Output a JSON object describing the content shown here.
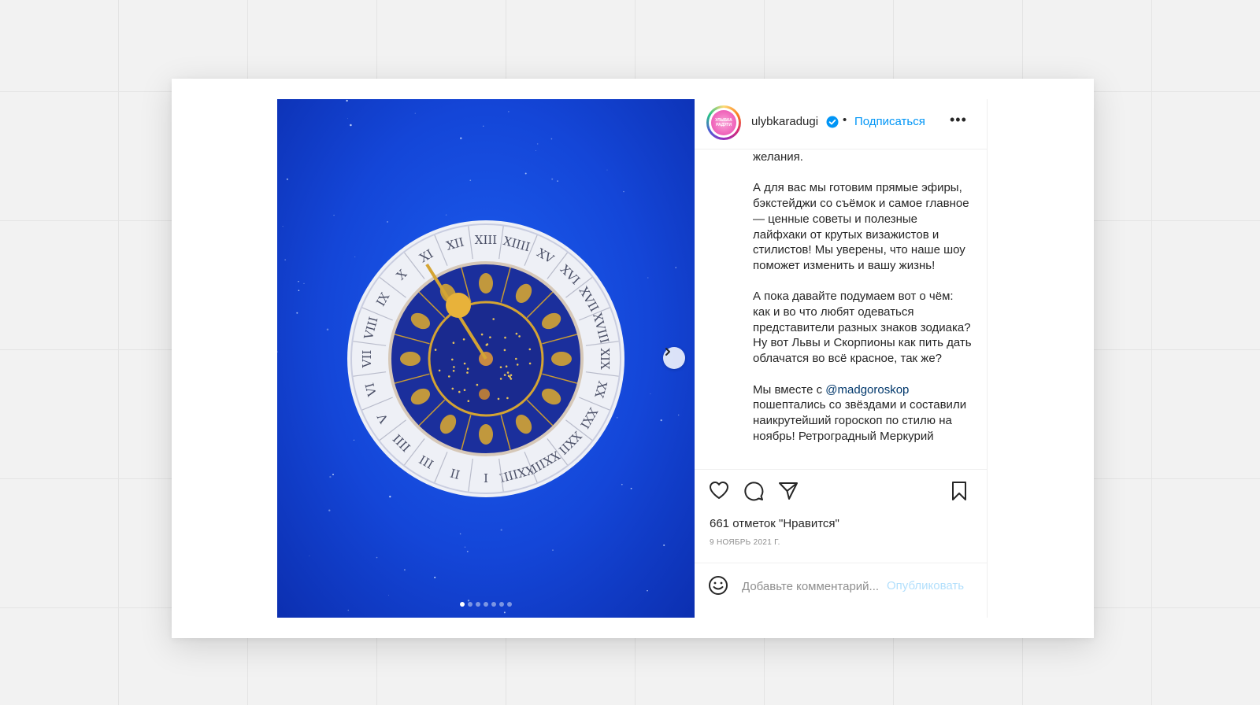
{
  "post": {
    "username": "ulybkaradugi",
    "separator": "•",
    "follow_label": "Подписаться",
    "more_label": "•••",
    "avatar_text": "УЛЫБКА РАДУГИ",
    "caption": {
      "p1": "желания.",
      "p2": "А для вас мы готовим прямые эфиры, бэкстейджи со съёмок и самое главное — ценные советы и полезные лайфхаки от крутых визажистов и стилистов! Мы уверены, что наше шоу поможет изменить и вашу жизнь!",
      "p3": "А пока давайте подумаем вот о чём: как и во что любят одеваться представители разных знаков зодиака? Ну вот Львы и Скорпионы как пить дать облачатся во всё красное, так же?",
      "p4_before": "Мы вместе с ",
      "p4_mention": "@madgoroskop",
      "p4_after": " пошептались со звёздами и составили наикрутейший гороскоп по стилю на ноябрь! Ретроградный Меркурий"
    },
    "likes_text": "661 отметок \"Нравится\"",
    "date_text": "9 НОЯБРЬ 2021 Г.",
    "comment_placeholder": "Добавьте комментарий...",
    "publish_label": "Опубликовать",
    "carousel": {
      "slides": 7,
      "active_index": 0
    },
    "clock": {
      "numerals": [
        "I",
        "II",
        "III",
        "IIII",
        "V",
        "VI",
        "VII",
        "VIII",
        "IX",
        "X",
        "XI",
        "XII",
        "XIII",
        "XIIII",
        "XV",
        "XVI",
        "XVII",
        "XVIII",
        "XIX",
        "XX",
        "XXI",
        "XXII",
        "XXIII",
        "XXIIII"
      ]
    }
  },
  "colors": {
    "accent": "#0095f6",
    "publish_disabled": "#b2dffc",
    "photo_bg": "#1446d8",
    "dial_blue": "#1b2f9c",
    "gold": "#d4a433"
  },
  "icons": [
    "verified-badge-icon",
    "more-options-icon",
    "next-slide-icon",
    "heart-icon",
    "comment-icon",
    "share-icon",
    "bookmark-icon",
    "emoji-icon"
  ]
}
